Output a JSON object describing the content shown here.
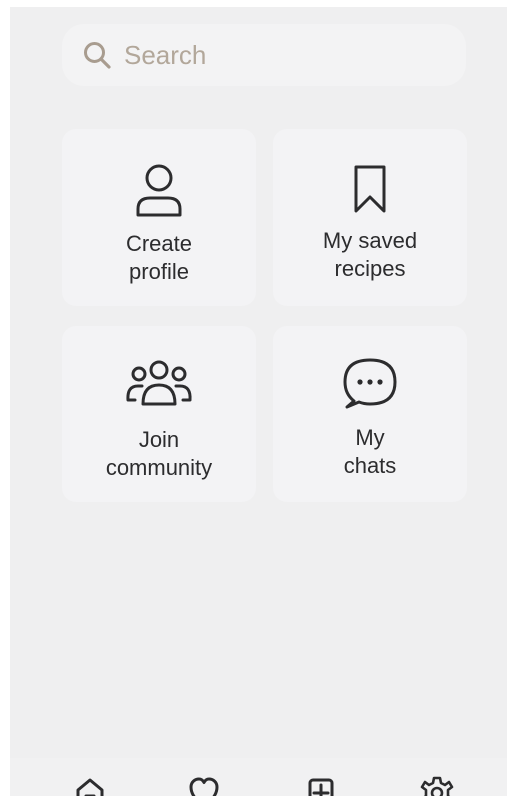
{
  "search": {
    "placeholder": "Search",
    "icon": "search-icon"
  },
  "tiles": [
    {
      "id": "create-profile",
      "line1": "Create",
      "line2": "profile",
      "icon": "person-icon"
    },
    {
      "id": "saved-recipes",
      "line1": "My saved",
      "line2": "recipes",
      "icon": "bookmark-icon"
    },
    {
      "id": "join-community",
      "line1": "Join",
      "line2": "community",
      "icon": "group-icon"
    },
    {
      "id": "my-chats",
      "line1": "My",
      "line2": "chats",
      "icon": "chat-bubble-icon"
    }
  ],
  "tab_bar": {
    "items": [
      {
        "icon": "home-icon"
      },
      {
        "icon": "heart-icon"
      },
      {
        "icon": "add-square-icon"
      },
      {
        "icon": "settings-gear-icon"
      }
    ]
  },
  "colors": {
    "background": "#efeff0",
    "tile": "#f3f3f5",
    "icon_stroke": "#2c2c2e",
    "search_placeholder": "#b2a79a",
    "search_icon": "#a89c8f"
  }
}
